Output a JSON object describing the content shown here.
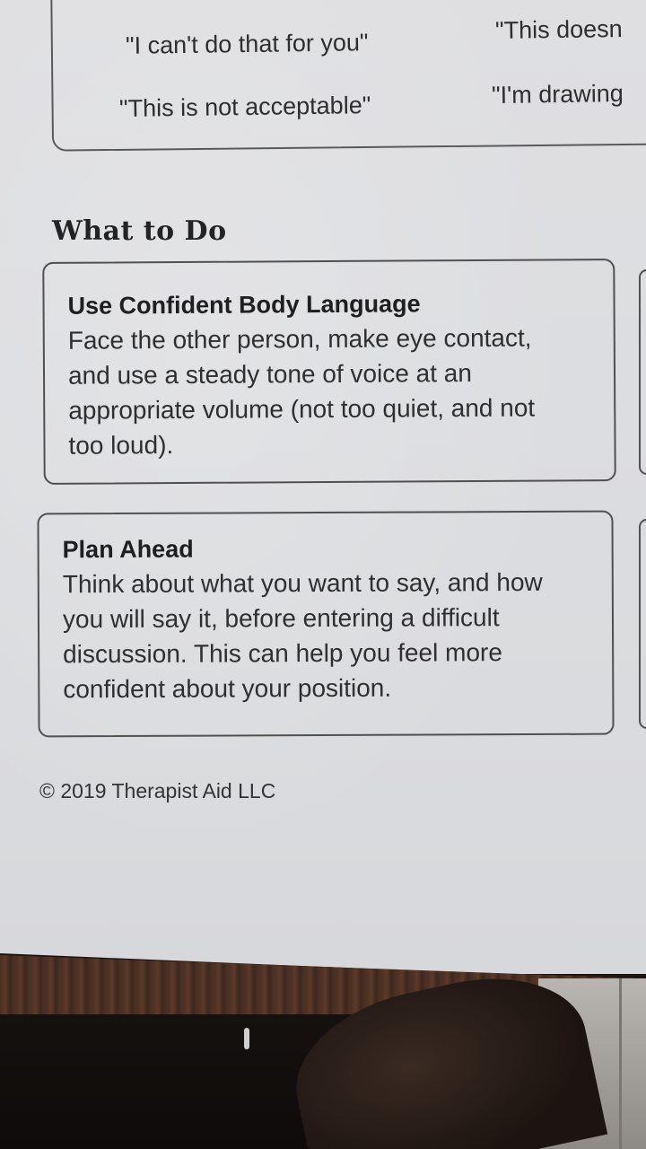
{
  "quotes": {
    "q1": "\"I can't do that for you\"",
    "q2": "\"This doesn",
    "q3": "\"This is not acceptable\"",
    "q4": "\"I'm drawing"
  },
  "section": {
    "title": "What to Do"
  },
  "cards": [
    {
      "title": "Use Confident Body Language",
      "lines": [
        "Face the other person, make eye contact,",
        "and use a steady tone of voice at an",
        "appropriate volume (not too quiet, and not",
        "too loud)."
      ]
    },
    {
      "title": "Plan Ahead",
      "lines": [
        "Think about what you want to say, and how",
        "you will say it, before entering a difficult",
        "discussion. This can help you feel more",
        "confident about your position."
      ]
    }
  ],
  "footer": {
    "copyright": "© 2019 Therapist Aid LLC"
  }
}
